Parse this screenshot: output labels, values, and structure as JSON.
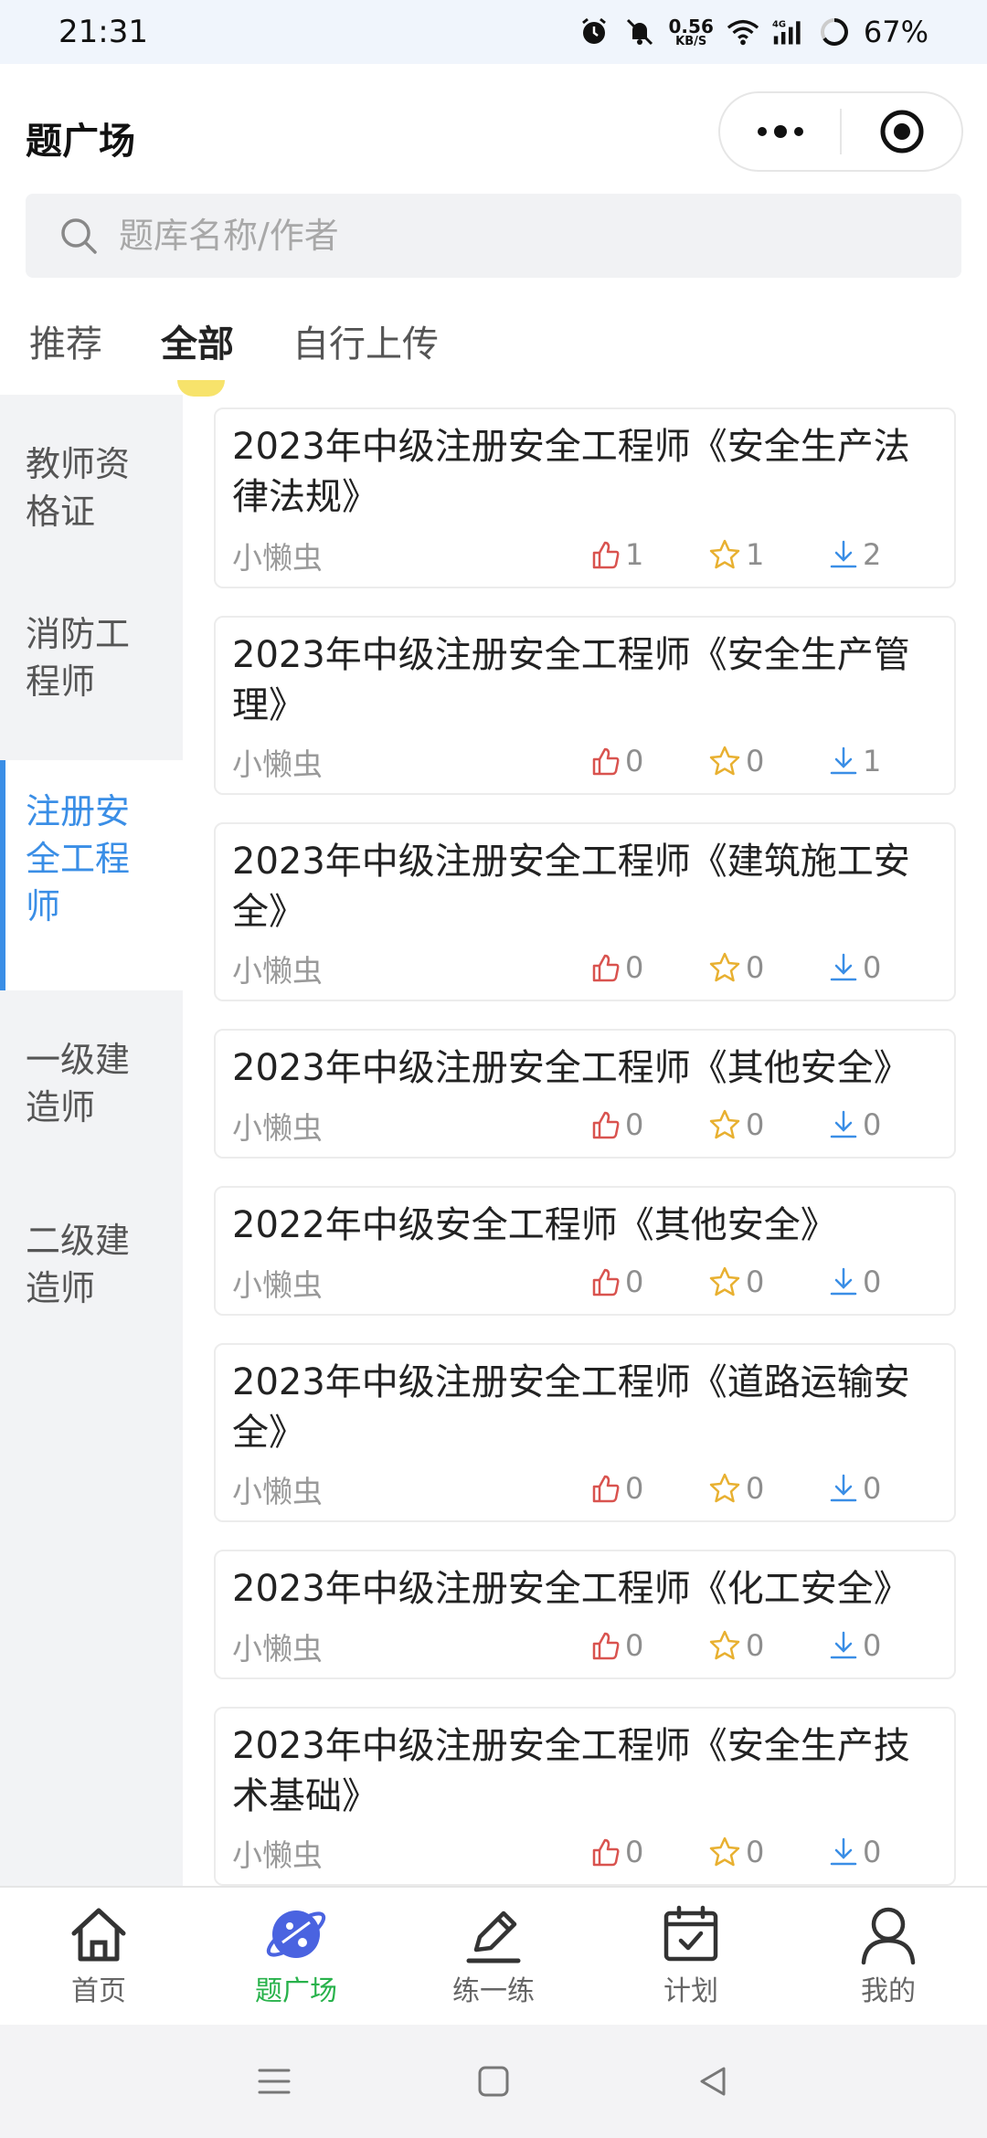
{
  "status_bar": {
    "time": "21:31",
    "net_speed": "0.56",
    "net_unit": "KB/S",
    "battery": "67%",
    "icons": [
      "alarm-icon",
      "mute-icon",
      "wifi-icon",
      "signal-4g-icon",
      "battery-ring-icon"
    ]
  },
  "header": {
    "title": "题广场"
  },
  "search": {
    "placeholder": "题库名称/作者"
  },
  "tabs": [
    {
      "label": "推荐",
      "active": false
    },
    {
      "label": "全部",
      "active": true
    },
    {
      "label": "自行上传",
      "active": false
    }
  ],
  "sidebar": {
    "items": [
      {
        "label": "教师资格证",
        "active": false
      },
      {
        "label": "消防工程师",
        "active": false
      },
      {
        "label": "注册安全工程师",
        "active": true
      },
      {
        "label": "一级建造师",
        "active": false
      },
      {
        "label": "二级建造师",
        "active": false
      }
    ]
  },
  "cards": [
    {
      "title": "2023年中级注册安全工程师《安全生产法律法规》",
      "author": "小懒虫",
      "likes": "1",
      "stars": "1",
      "downloads": "2"
    },
    {
      "title": "2023年中级注册安全工程师《安全生产管理》",
      "author": "小懒虫",
      "likes": "0",
      "stars": "0",
      "downloads": "1"
    },
    {
      "title": "2023年中级注册安全工程师《建筑施工安全》",
      "author": "小懒虫",
      "likes": "0",
      "stars": "0",
      "downloads": "0"
    },
    {
      "title": "2023年中级注册安全工程师《其他安全》",
      "author": "小懒虫",
      "likes": "0",
      "stars": "0",
      "downloads": "0"
    },
    {
      "title": "2022年中级安全工程师《其他安全》",
      "author": "小懒虫",
      "likes": "0",
      "stars": "0",
      "downloads": "0"
    },
    {
      "title": "2023年中级注册安全工程师《道路运输安全》",
      "author": "小懒虫",
      "likes": "0",
      "stars": "0",
      "downloads": "0"
    },
    {
      "title": "2023年中级注册安全工程师《化工安全》",
      "author": "小懒虫",
      "likes": "0",
      "stars": "0",
      "downloads": "0"
    },
    {
      "title": "2023年中级注册安全工程师《安全生产技术基础》",
      "author": "小懒虫",
      "likes": "0",
      "stars": "0",
      "downloads": "0"
    }
  ],
  "bottom_nav": [
    {
      "label": "首页",
      "icon": "home-icon",
      "active": false
    },
    {
      "label": "题广场",
      "icon": "planet-icon",
      "active": true
    },
    {
      "label": "练一练",
      "icon": "pencil-icon",
      "active": false
    },
    {
      "label": "计划",
      "icon": "calendar-icon",
      "active": false
    },
    {
      "label": "我的",
      "icon": "user-icon",
      "active": false
    }
  ],
  "colors": {
    "accent_blue": "#3a8ee6",
    "active_green": "#28b24b",
    "like_red": "#d9534f",
    "star_yellow": "#e8b030",
    "download_blue": "#3a8ee6",
    "tab_indicator": "#f7e36b"
  }
}
